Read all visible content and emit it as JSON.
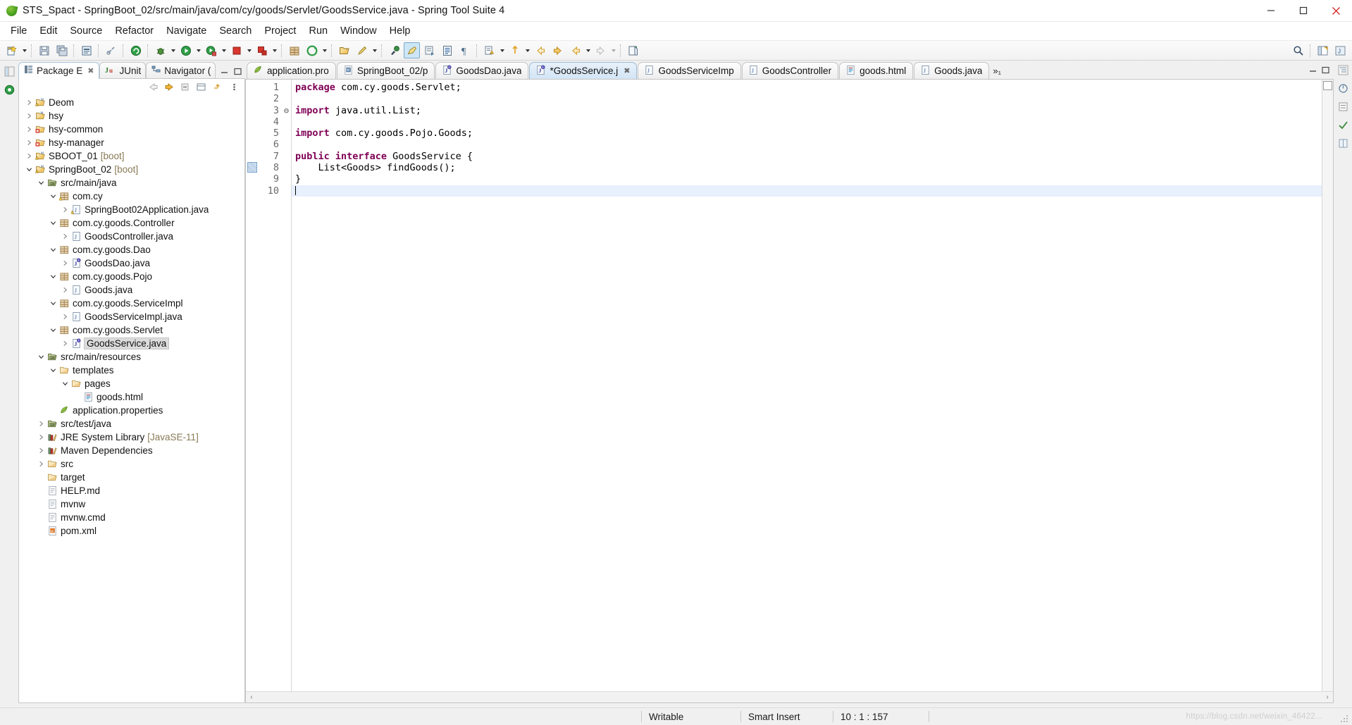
{
  "window": {
    "title": "STS_Spact - SpringBoot_02/src/main/java/com/cy/goods/Servlet/GoodsService.java - Spring Tool Suite 4",
    "app_icon": "sts-leaf-icon",
    "minimize": "—",
    "maximize": "❐",
    "close": "✕"
  },
  "menubar": {
    "items": [
      {
        "label": "File"
      },
      {
        "label": "Edit"
      },
      {
        "label": "Source"
      },
      {
        "label": "Refactor"
      },
      {
        "label": "Navigate"
      },
      {
        "label": "Search"
      },
      {
        "label": "Project"
      },
      {
        "label": "Run"
      },
      {
        "label": "Window"
      },
      {
        "label": "Help"
      }
    ]
  },
  "toolbar": {
    "items": [
      {
        "icon": "new-wizard-icon",
        "dropdown": true
      },
      {
        "sep": true
      },
      {
        "icon": "save-icon"
      },
      {
        "icon": "save-all-icon"
      },
      {
        "sep": true
      },
      {
        "icon": "print-icon"
      },
      {
        "sep": true
      },
      {
        "icon": "link-broken-icon"
      },
      {
        "sep": true
      },
      {
        "icon": "boot-dashboard-icon"
      },
      {
        "sep": true
      },
      {
        "icon": "debug-icon",
        "dropdown": true
      },
      {
        "icon": "run-icon",
        "dropdown": true
      },
      {
        "icon": "run-configurations-icon",
        "dropdown": true
      },
      {
        "icon": "stop-red-icon",
        "dropdown": true
      },
      {
        "icon": "terminate-relaunch-icon",
        "dropdown": true
      },
      {
        "sep": true
      },
      {
        "icon": "new-package-icon"
      },
      {
        "icon": "new-project-icon",
        "dropdown": true
      },
      {
        "sep": true
      },
      {
        "icon": "open-type-icon"
      },
      {
        "icon": "new-class-icon",
        "dropdown": true
      },
      {
        "sep": true
      },
      {
        "icon": "external-tools-icon"
      },
      {
        "icon": "toggle-mark-occurrences-icon",
        "active": true
      },
      {
        "icon": "skip-breakpoints-icon"
      },
      {
        "icon": "show-whitespace-icon"
      },
      {
        "icon": "pilcrow-icon"
      },
      {
        "sep": true
      },
      {
        "icon": "next-annotation-icon",
        "dropdown": true
      },
      {
        "icon": "previous-annotation-icon",
        "dropdown": true
      },
      {
        "icon": "back-icon"
      },
      {
        "icon": "forward-icon"
      },
      {
        "icon": "last-edit-location-icon",
        "dropdown": true
      },
      {
        "icon": "forward-history-icon",
        "dropdown": true,
        "dim": true
      },
      {
        "sep": true
      },
      {
        "icon": "new-java-project-icon"
      }
    ],
    "right_items": [
      {
        "icon": "search-icon"
      },
      {
        "icon": "perspective-open-icon"
      },
      {
        "icon": "perspective-java-icon"
      }
    ]
  },
  "explorer": {
    "tabs": [
      {
        "label": "Package E",
        "icon": "package-explorer-icon",
        "active": true,
        "closable": true
      },
      {
        "label": "JUnit",
        "icon": "junit-icon",
        "active": false,
        "closable": false
      },
      {
        "label": "Navigator (",
        "icon": "navigator-icon",
        "active": false,
        "closable": false
      }
    ],
    "view_min": "━",
    "view_max": "□",
    "toolbar_icons": [
      "back-arrow-icon",
      "forward-arrow-icon",
      "collapse-up-icon",
      "collapse-all-icon",
      "link-with-editor-icon",
      "view-menu-icon"
    ],
    "tree": [
      {
        "indent": 0,
        "twisty": "collapsed",
        "icon": "java-project-warn-icon",
        "label": "Deom",
        "sub": ""
      },
      {
        "indent": 0,
        "twisty": "collapsed",
        "icon": "maven-project-icon",
        "label": "hsy",
        "sub": ""
      },
      {
        "indent": 0,
        "twisty": "collapsed",
        "icon": "maven-project-error-icon",
        "label": "hsy-common",
        "sub": ""
      },
      {
        "indent": 0,
        "twisty": "collapsed",
        "icon": "maven-project-error-icon",
        "label": "hsy-manager",
        "sub": ""
      },
      {
        "indent": 0,
        "twisty": "collapsed",
        "icon": "java-project-warn-icon",
        "label": "SBOOT_01",
        "sub": "[boot]"
      },
      {
        "indent": 0,
        "twisty": "expanded",
        "icon": "java-project-warn-icon",
        "label": "SpringBoot_02",
        "sub": "[boot]"
      },
      {
        "indent": 1,
        "twisty": "expanded",
        "icon": "source-folder-icon",
        "label": "src/main/java",
        "sub": ""
      },
      {
        "indent": 2,
        "twisty": "expanded",
        "icon": "package-warn-icon",
        "label": "com.cy",
        "sub": ""
      },
      {
        "indent": 3,
        "twisty": "collapsed",
        "icon": "java-file-warn-icon",
        "label": "SpringBoot02Application.java",
        "sub": ""
      },
      {
        "indent": 2,
        "twisty": "expanded",
        "icon": "package-icon",
        "label": "com.cy.goods.Controller",
        "sub": ""
      },
      {
        "indent": 3,
        "twisty": "collapsed",
        "icon": "java-file-icon",
        "label": "GoodsController.java",
        "sub": ""
      },
      {
        "indent": 2,
        "twisty": "expanded",
        "icon": "package-icon",
        "label": "com.cy.goods.Dao",
        "sub": ""
      },
      {
        "indent": 3,
        "twisty": "collapsed",
        "icon": "java-interface-icon",
        "label": "GoodsDao.java",
        "sub": ""
      },
      {
        "indent": 2,
        "twisty": "expanded",
        "icon": "package-icon",
        "label": "com.cy.goods.Pojo",
        "sub": ""
      },
      {
        "indent": 3,
        "twisty": "collapsed",
        "icon": "java-file-icon",
        "label": "Goods.java",
        "sub": ""
      },
      {
        "indent": 2,
        "twisty": "expanded",
        "icon": "package-icon",
        "label": "com.cy.goods.ServiceImpl",
        "sub": ""
      },
      {
        "indent": 3,
        "twisty": "collapsed",
        "icon": "java-file-icon",
        "label": "GoodsServiceImpl.java",
        "sub": ""
      },
      {
        "indent": 2,
        "twisty": "expanded",
        "icon": "package-icon",
        "label": "com.cy.goods.Servlet",
        "sub": ""
      },
      {
        "indent": 3,
        "twisty": "collapsed",
        "icon": "java-interface-icon",
        "label": "GoodsService.java",
        "sub": "",
        "selected": true
      },
      {
        "indent": 1,
        "twisty": "expanded",
        "icon": "source-folder-icon",
        "label": "src/main/resources",
        "sub": ""
      },
      {
        "indent": 2,
        "twisty": "expanded",
        "icon": "folder-icon",
        "label": "templates",
        "sub": ""
      },
      {
        "indent": 3,
        "twisty": "expanded",
        "icon": "folder-icon",
        "label": "pages",
        "sub": ""
      },
      {
        "indent": 4,
        "twisty": "none",
        "icon": "html-file-icon",
        "label": "goods.html",
        "sub": ""
      },
      {
        "indent": 2,
        "twisty": "none",
        "icon": "properties-file-icon",
        "label": "application.properties",
        "sub": ""
      },
      {
        "indent": 1,
        "twisty": "collapsed",
        "icon": "source-folder-icon",
        "label": "src/test/java",
        "sub": ""
      },
      {
        "indent": 1,
        "twisty": "collapsed",
        "icon": "library-icon",
        "label": "JRE System Library",
        "sub": "[JavaSE-11]"
      },
      {
        "indent": 1,
        "twisty": "collapsed",
        "icon": "library-icon",
        "label": "Maven Dependencies",
        "sub": ""
      },
      {
        "indent": 1,
        "twisty": "collapsed",
        "icon": "folder-icon",
        "label": "src",
        "sub": ""
      },
      {
        "indent": 1,
        "twisty": "none",
        "icon": "folder-icon",
        "label": "target",
        "sub": ""
      },
      {
        "indent": 1,
        "twisty": "none",
        "icon": "text-file-icon",
        "label": "HELP.md",
        "sub": ""
      },
      {
        "indent": 1,
        "twisty": "none",
        "icon": "text-file-icon",
        "label": "mvnw",
        "sub": ""
      },
      {
        "indent": 1,
        "twisty": "none",
        "icon": "text-file-icon",
        "label": "mvnw.cmd",
        "sub": ""
      },
      {
        "indent": 1,
        "twisty": "none",
        "icon": "xml-file-icon",
        "label": "pom.xml",
        "sub": ""
      }
    ]
  },
  "editor": {
    "tabs": [
      {
        "label": "application.pro",
        "icon": "properties-file-icon",
        "active": false,
        "dirty": false,
        "closable": false
      },
      {
        "label": "SpringBoot_02/p",
        "icon": "maven-pom-icon",
        "active": false,
        "dirty": false,
        "closable": false
      },
      {
        "label": "GoodsDao.java",
        "icon": "java-interface-icon",
        "active": false,
        "dirty": false,
        "closable": false
      },
      {
        "label": "*GoodsService.j",
        "icon": "java-interface-icon",
        "active": true,
        "dirty": true,
        "closable": true
      },
      {
        "label": "GoodsServiceImp",
        "icon": "java-file-icon",
        "active": false,
        "dirty": false,
        "closable": false
      },
      {
        "label": "GoodsController",
        "icon": "java-file-icon",
        "active": false,
        "dirty": false,
        "closable": false
      },
      {
        "label": "goods.html",
        "icon": "html-file-icon",
        "active": false,
        "dirty": false,
        "closable": false
      },
      {
        "label": "Goods.java",
        "icon": "java-file-icon",
        "active": false,
        "dirty": false,
        "closable": false
      }
    ],
    "overflow_label": "»₁",
    "view_min": "━",
    "view_max": "□",
    "line_numbers": [
      "1",
      "2",
      "3",
      "4",
      "5",
      "6",
      "7",
      "8",
      "9",
      "10"
    ],
    "fold_markers": [
      "",
      "",
      "⊖",
      "",
      "",
      "",
      "",
      "",
      "",
      ""
    ],
    "code_lines": [
      {
        "n": 1,
        "segments": [
          {
            "t": "package",
            "k": true
          },
          {
            "t": " com.cy.goods.Servlet;",
            "k": false
          }
        ]
      },
      {
        "n": 2,
        "segments": [
          {
            "t": "",
            "k": false
          }
        ]
      },
      {
        "n": 3,
        "segments": [
          {
            "t": "import",
            "k": true
          },
          {
            "t": " java.util.List;",
            "k": false
          }
        ]
      },
      {
        "n": 4,
        "segments": [
          {
            "t": "",
            "k": false
          }
        ]
      },
      {
        "n": 5,
        "segments": [
          {
            "t": "import",
            "k": true
          },
          {
            "t": " com.cy.goods.Pojo.Goods;",
            "k": false
          }
        ]
      },
      {
        "n": 6,
        "segments": [
          {
            "t": "",
            "k": false
          }
        ]
      },
      {
        "n": 7,
        "segments": [
          {
            "t": "public interface",
            "k": true
          },
          {
            "t": " GoodsService {",
            "k": false
          }
        ]
      },
      {
        "n": 8,
        "segments": [
          {
            "t": "    List<Goods> findGoods();",
            "k": false
          }
        ]
      },
      {
        "n": 9,
        "segments": [
          {
            "t": "}",
            "k": false
          }
        ]
      },
      {
        "n": 10,
        "segments": [
          {
            "t": "",
            "k": false
          }
        ]
      }
    ],
    "cursor_line_index": 9,
    "hscroll_left": "‹",
    "hscroll_right": "›"
  },
  "statusbar": {
    "writable": "Writable",
    "insert_mode": "Smart Insert",
    "cursor_position": "10 : 1 : 157",
    "watermark": "https://blog.csdn.net/weixin_46422..."
  },
  "colors": {
    "keyword": "#7f0055",
    "accent_tab": "#d3e5f5",
    "selection": "#dcdcdc",
    "current_line": "#e8f0fe",
    "project_sub": "#8a7a55"
  }
}
